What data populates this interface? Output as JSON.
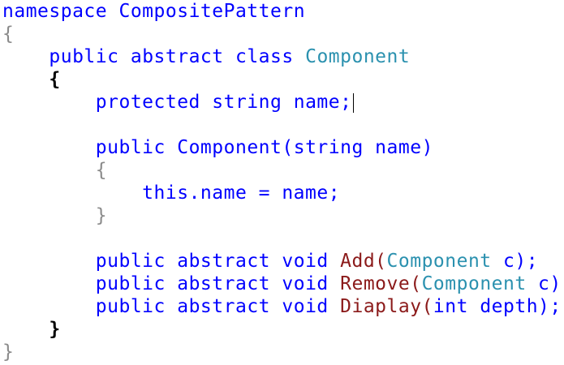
{
  "code": {
    "l1": {
      "kw": "namespace",
      "name": "CompositePattern"
    },
    "l2": {
      "brace": "{"
    },
    "l3": {
      "kw1": "public",
      "kw2": "abstract",
      "kw3": "class",
      "type": "Component"
    },
    "l4": {
      "brace": "{"
    },
    "l5": {
      "kw1": "protected",
      "kw2": "string",
      "rest": "name;"
    },
    "l7": {
      "kw1": "public",
      "ctor": "Component",
      "paren_open": "(",
      "kw2": "string",
      "param": "name",
      "paren_close": ")"
    },
    "l8": {
      "brace": "{"
    },
    "l9": {
      "kw": "this",
      "rest": ".name = name;"
    },
    "l10": {
      "brace": "}"
    },
    "l12": {
      "kw1": "public",
      "kw2": "abstract",
      "kw3": "void",
      "method": "Add",
      "paren_open": "(",
      "type": "Component",
      "rest": " c);"
    },
    "l13": {
      "kw1": "public",
      "kw2": "abstract",
      "kw3": "void",
      "method": "Remove",
      "paren_open": "(",
      "type": "Component",
      "rest": " c);"
    },
    "l14": {
      "kw1": "public",
      "kw2": "abstract",
      "kw3": "void",
      "method": "Diaplay",
      "paren_open": "(",
      "kw4": "int",
      "rest": " depth);"
    },
    "l15": {
      "brace": "}"
    },
    "l16": {
      "brace": "}"
    }
  },
  "colors": {
    "keyword": "#0000ff",
    "type": "#2b91af",
    "method": "#8b1a1a",
    "brace_dim": "#8a8a8a",
    "background": "#ffffff"
  }
}
